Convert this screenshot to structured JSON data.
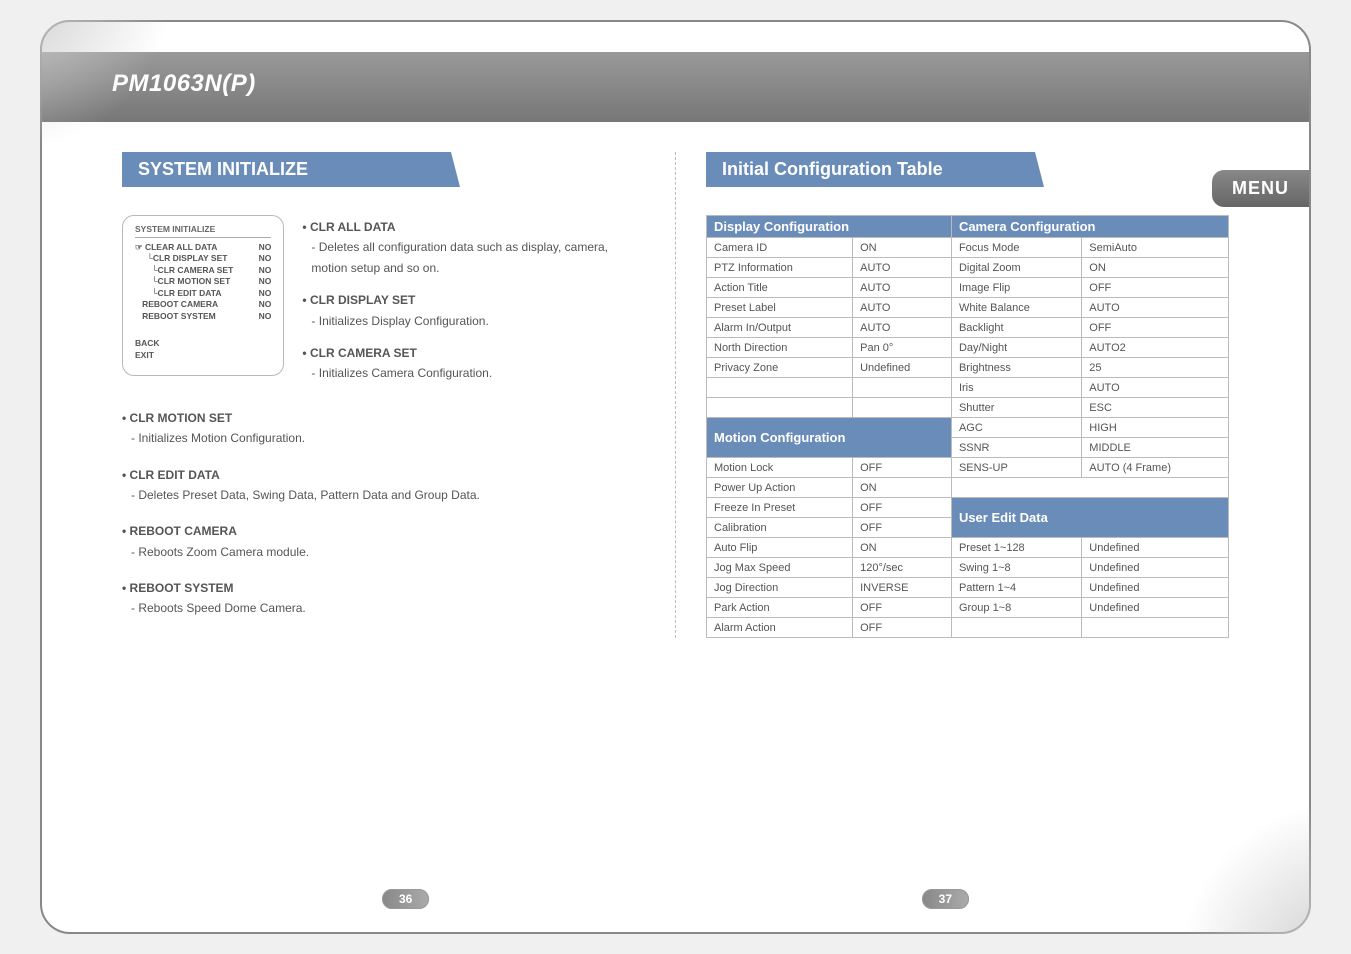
{
  "header": {
    "title": "PM1063N(P)",
    "tab": "MENU"
  },
  "left": {
    "section_title": "SYSTEM INITIALIZE",
    "menu_box": {
      "title": "SYSTEM INITIALIZE",
      "rows": [
        {
          "name": "☞ CLEAR ALL DATA",
          "val": "NO"
        },
        {
          "name": "     └CLR DISPLAY SET",
          "val": "NO"
        },
        {
          "name": "       └CLR CAMERA SET",
          "val": "NO"
        },
        {
          "name": "       └CLR MOTION SET",
          "val": "NO"
        },
        {
          "name": "       └CLR EDIT DATA",
          "val": "NO"
        },
        {
          "name": "   REBOOT CAMERA",
          "val": "NO"
        },
        {
          "name": "   REBOOT SYSTEM",
          "val": "NO"
        }
      ],
      "back": "BACK",
      "exit": "EXIT"
    },
    "top_desc": [
      {
        "title": "• CLR ALL DATA",
        "text": "- Deletes all configuration data such as display, camera, motion setup and so on."
      },
      {
        "title": "• CLR DISPLAY SET",
        "text": "- Initializes Display Configuration."
      },
      {
        "title": "• CLR CAMERA SET",
        "text": "- Initializes Camera Configuration."
      }
    ],
    "lower_desc": [
      {
        "title": "• CLR MOTION SET",
        "text": "- Initializes Motion Configuration."
      },
      {
        "title": "• CLR EDIT DATA",
        "text": "- Deletes Preset Data, Swing Data, Pattern Data and Group Data."
      },
      {
        "title": "• REBOOT CAMERA",
        "text": "- Reboots Zoom Camera module."
      },
      {
        "title": "• REBOOT SYSTEM",
        "text": "- Reboots Speed Dome Camera."
      }
    ],
    "page_num": "36"
  },
  "right": {
    "section_title": "Initial Configuration Table",
    "headers": {
      "display": "Display Configuration",
      "camera": "Camera Configuration",
      "motion": "Motion Configuration",
      "user": "User Edit Data"
    },
    "display_rows": [
      [
        "Camera ID",
        "ON"
      ],
      [
        "PTZ Information",
        "AUTO"
      ],
      [
        "Action Title",
        "AUTO"
      ],
      [
        "Preset Label",
        "AUTO"
      ],
      [
        "Alarm In/Output",
        "AUTO"
      ],
      [
        "North Direction",
        "Pan 0°"
      ],
      [
        "Privacy Zone",
        "Undefined"
      ]
    ],
    "camera_rows": [
      [
        "Focus Mode",
        "SemiAuto"
      ],
      [
        "Digital Zoom",
        "ON"
      ],
      [
        "Image Flip",
        "OFF"
      ],
      [
        "White Balance",
        "AUTO"
      ],
      [
        "Backlight",
        "OFF"
      ],
      [
        "Day/Night",
        "AUTO2"
      ],
      [
        "Brightness",
        "25"
      ],
      [
        "Iris",
        "AUTO"
      ],
      [
        "Shutter",
        "ESC"
      ],
      [
        "AGC",
        "HIGH"
      ],
      [
        "SSNR",
        "MIDDLE"
      ],
      [
        "SENS-UP",
        "AUTO (4 Frame)"
      ]
    ],
    "motion_rows": [
      [
        "Motion Lock",
        "OFF"
      ],
      [
        "Power Up Action",
        "ON"
      ],
      [
        "Freeze In Preset",
        "OFF"
      ],
      [
        "Calibration",
        "OFF"
      ],
      [
        "Auto Flip",
        "ON"
      ],
      [
        "Jog Max Speed",
        "120°/sec"
      ],
      [
        "Jog Direction",
        "INVERSE"
      ],
      [
        "Park Action",
        "OFF"
      ],
      [
        "Alarm Action",
        "OFF"
      ]
    ],
    "user_rows": [
      [
        "Preset 1~128",
        "Undefined"
      ],
      [
        "Swing 1~8",
        "Undefined"
      ],
      [
        "Pattern 1~4",
        "Undefined"
      ],
      [
        "Group 1~8",
        "Undefined"
      ]
    ],
    "page_num": "37"
  }
}
